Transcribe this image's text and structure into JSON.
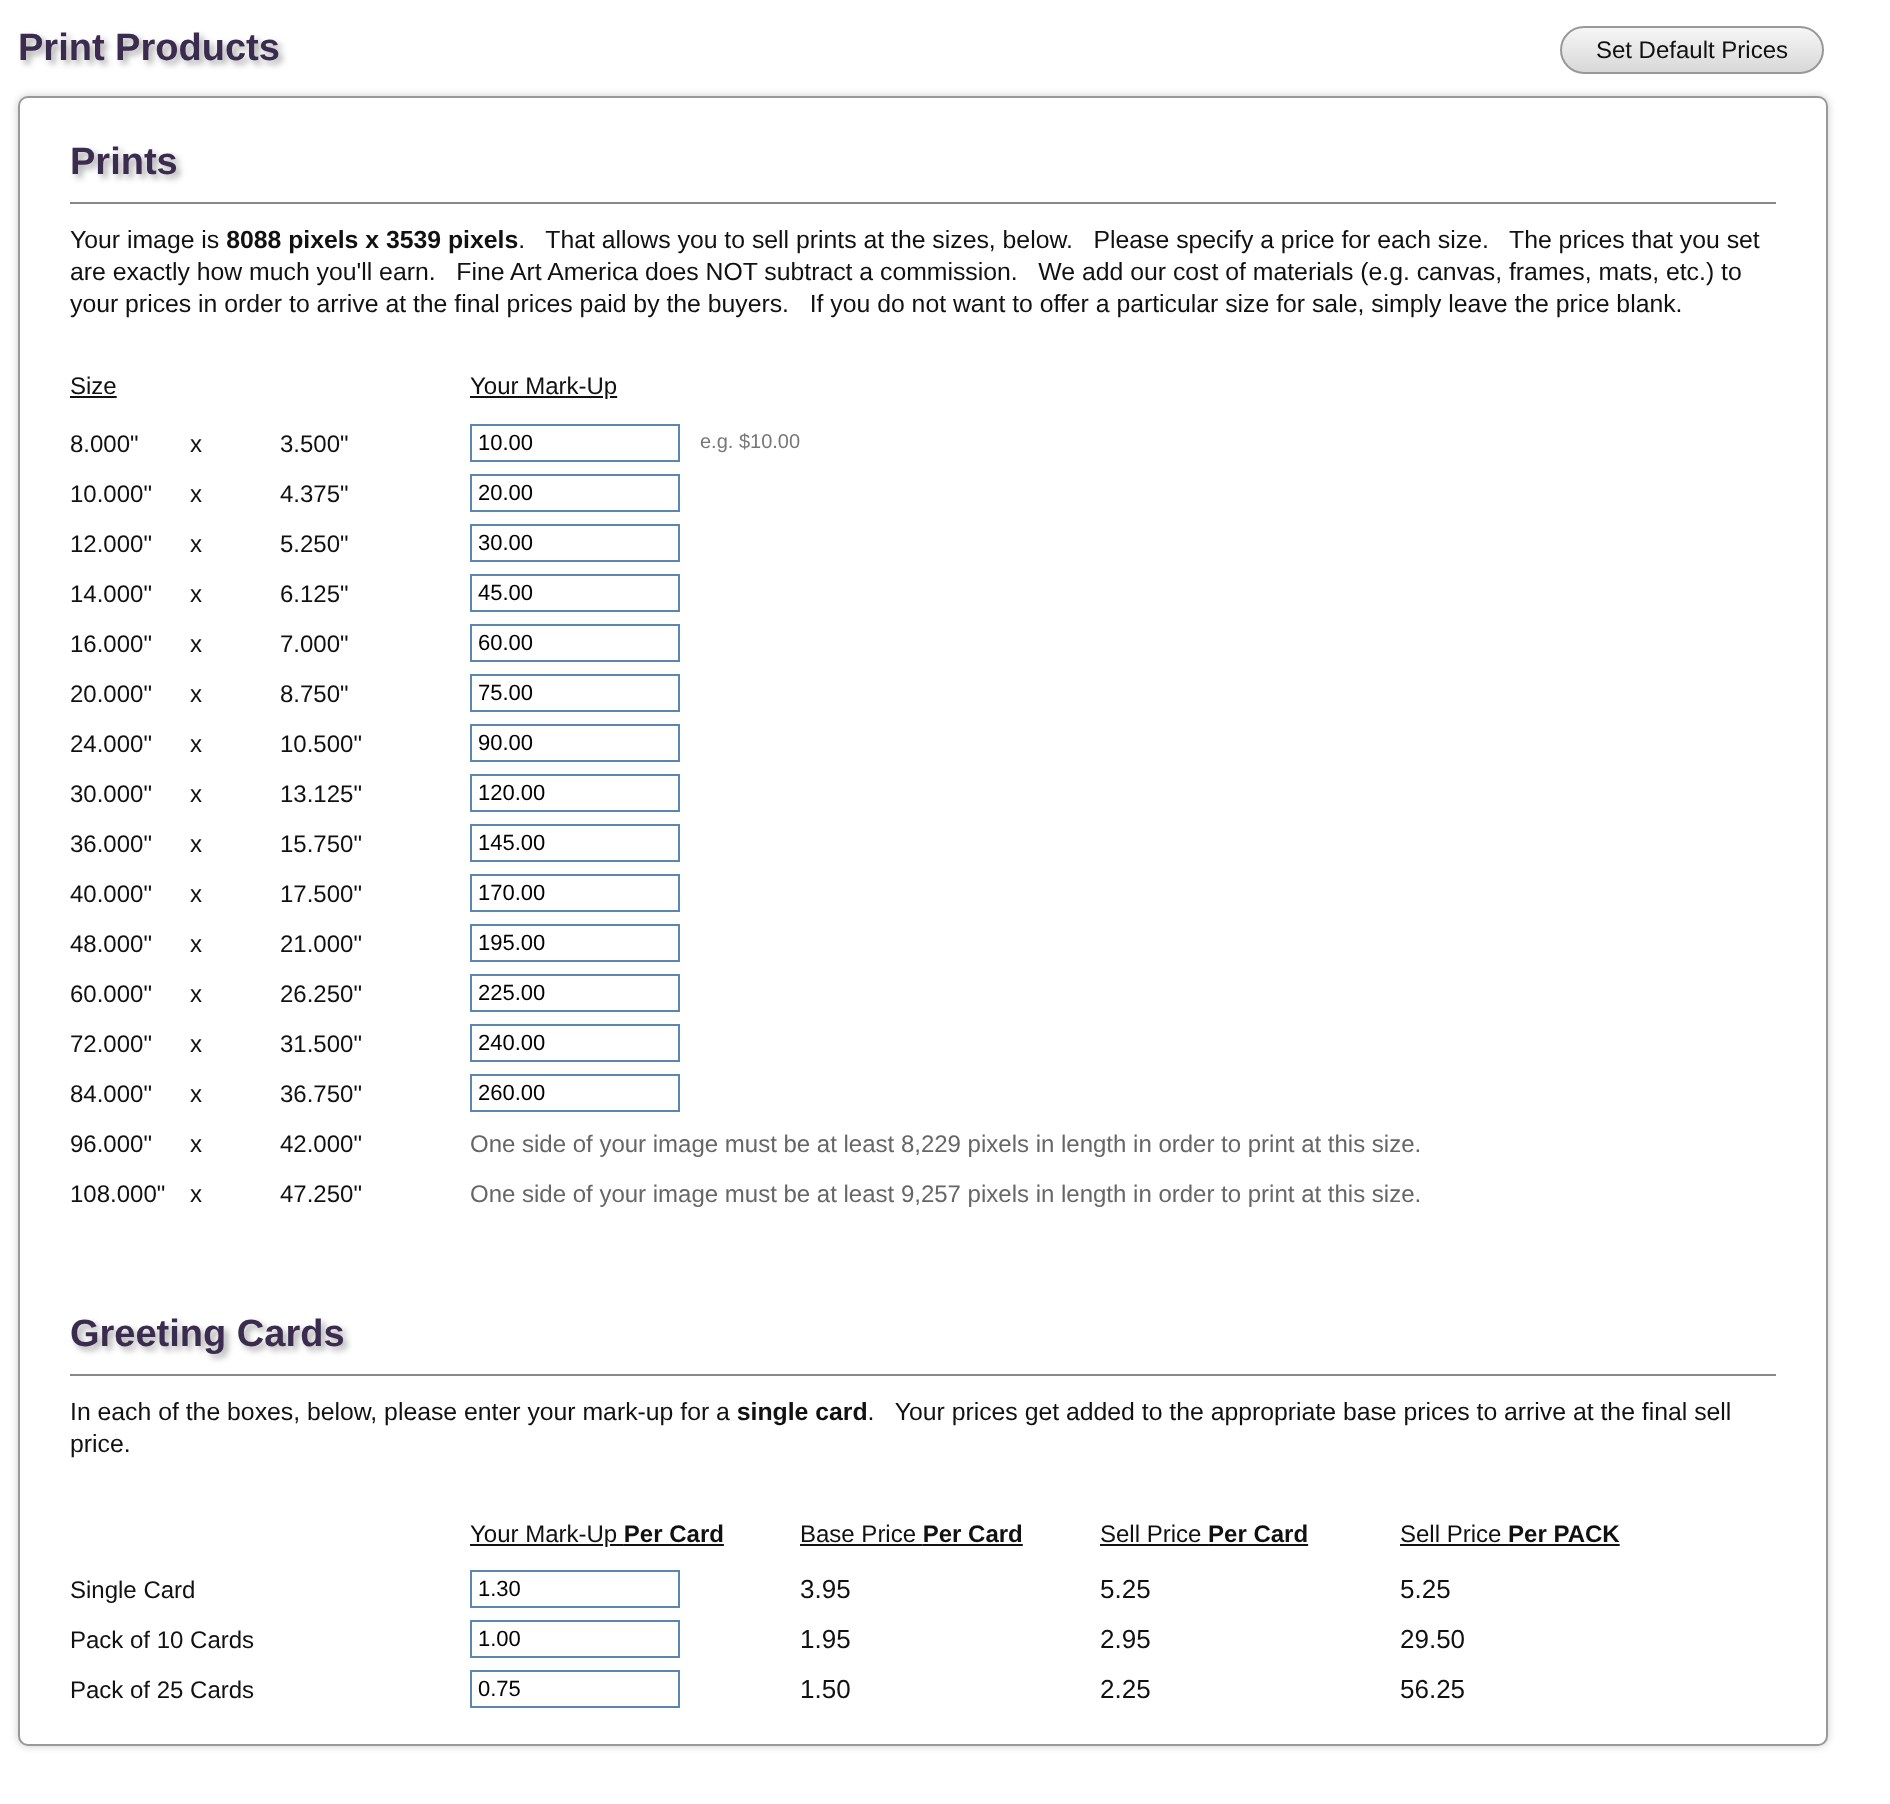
{
  "page_title": "Print Products",
  "default_button": "Set Default Prices",
  "prints": {
    "heading": "Prints",
    "intro": "Your image is **8088 pixels x 3539 pixels**.   That allows you to sell prints at the sizes, below.   Please specify a price for each size.   The prices that you set are exactly how much you'll earn.   Fine Art America does NOT subtract a commission.   We add our cost of materials (e.g. canvas, frames, mats, etc.) to your prices in order to arrive at the final prices paid by the buyers.   If you do not want to offer a particular size for sale, simply leave the price blank.",
    "columns": [
      "Size",
      "Your Mark-Up"
    ],
    "hint": "e.g. $10.00",
    "rows": [
      {
        "kind": "input",
        "width": "8.000\"",
        "x": "x",
        "height": "3.500\"",
        "markup": "10.00"
      },
      {
        "kind": "input",
        "width": "10.000\"",
        "x": "x",
        "height": "4.375\"",
        "markup": "20.00"
      },
      {
        "kind": "input",
        "width": "12.000\"",
        "x": "x",
        "height": "5.250\"",
        "markup": "30.00"
      },
      {
        "kind": "input",
        "width": "14.000\"",
        "x": "x",
        "height": "6.125\"",
        "markup": "45.00"
      },
      {
        "kind": "input",
        "width": "16.000\"",
        "x": "x",
        "height": "7.000\"",
        "markup": "60.00"
      },
      {
        "kind": "input",
        "width": "20.000\"",
        "x": "x",
        "height": "8.750\"",
        "markup": "75.00"
      },
      {
        "kind": "input",
        "width": "24.000\"",
        "x": "x",
        "height": "10.500\"",
        "markup": "90.00"
      },
      {
        "kind": "input",
        "width": "30.000\"",
        "x": "x",
        "height": "13.125\"",
        "markup": "120.00"
      },
      {
        "kind": "input",
        "width": "36.000\"",
        "x": "x",
        "height": "15.750\"",
        "markup": "145.00"
      },
      {
        "kind": "input",
        "width": "40.000\"",
        "x": "x",
        "height": "17.500\"",
        "markup": "170.00"
      },
      {
        "kind": "input",
        "width": "48.000\"",
        "x": "x",
        "height": "21.000\"",
        "markup": "195.00"
      },
      {
        "kind": "input",
        "width": "60.000\"",
        "x": "x",
        "height": "26.250\"",
        "markup": "225.00"
      },
      {
        "kind": "input",
        "width": "72.000\"",
        "x": "x",
        "height": "31.500\"",
        "markup": "240.00"
      },
      {
        "kind": "input",
        "width": "84.000\"",
        "x": "x",
        "height": "36.750\"",
        "markup": "260.00"
      },
      {
        "kind": "note",
        "width": "96.000\"",
        "x": "x",
        "height": "42.000\"",
        "note": "One side of your image must be at least 8,229 pixels in length in order to print at this size."
      },
      {
        "kind": "note",
        "width": "108.000\"",
        "x": "x",
        "height": "47.250\"",
        "note": "One side of your image must be at least 9,257 pixels in length in order to print at this size."
      }
    ]
  },
  "greeting_cards": {
    "heading": "Greeting Cards",
    "intro": "In each of the boxes, below, please enter your mark-up for a **single card**.   Your prices get added to the appropriate base prices to arrive at the final sell price.",
    "columns": [
      "Your Mark-Up **Per Card**",
      "Base Price **Per Card**",
      "Sell Price **Per Card**",
      "Sell Price **Per PACK**"
    ],
    "rows": [
      {
        "name": "Single Card",
        "markup": "1.30",
        "base": "3.95",
        "sell_card": "5.25",
        "sell_pack": "5.25"
      },
      {
        "name": "Pack of 10 Cards",
        "markup": "1.00",
        "base": "1.95",
        "sell_card": "2.95",
        "sell_pack": "29.50"
      },
      {
        "name": "Pack of 25 Cards",
        "markup": "0.75",
        "base": "1.50",
        "sell_card": "2.25",
        "sell_pack": "56.25"
      }
    ]
  }
}
